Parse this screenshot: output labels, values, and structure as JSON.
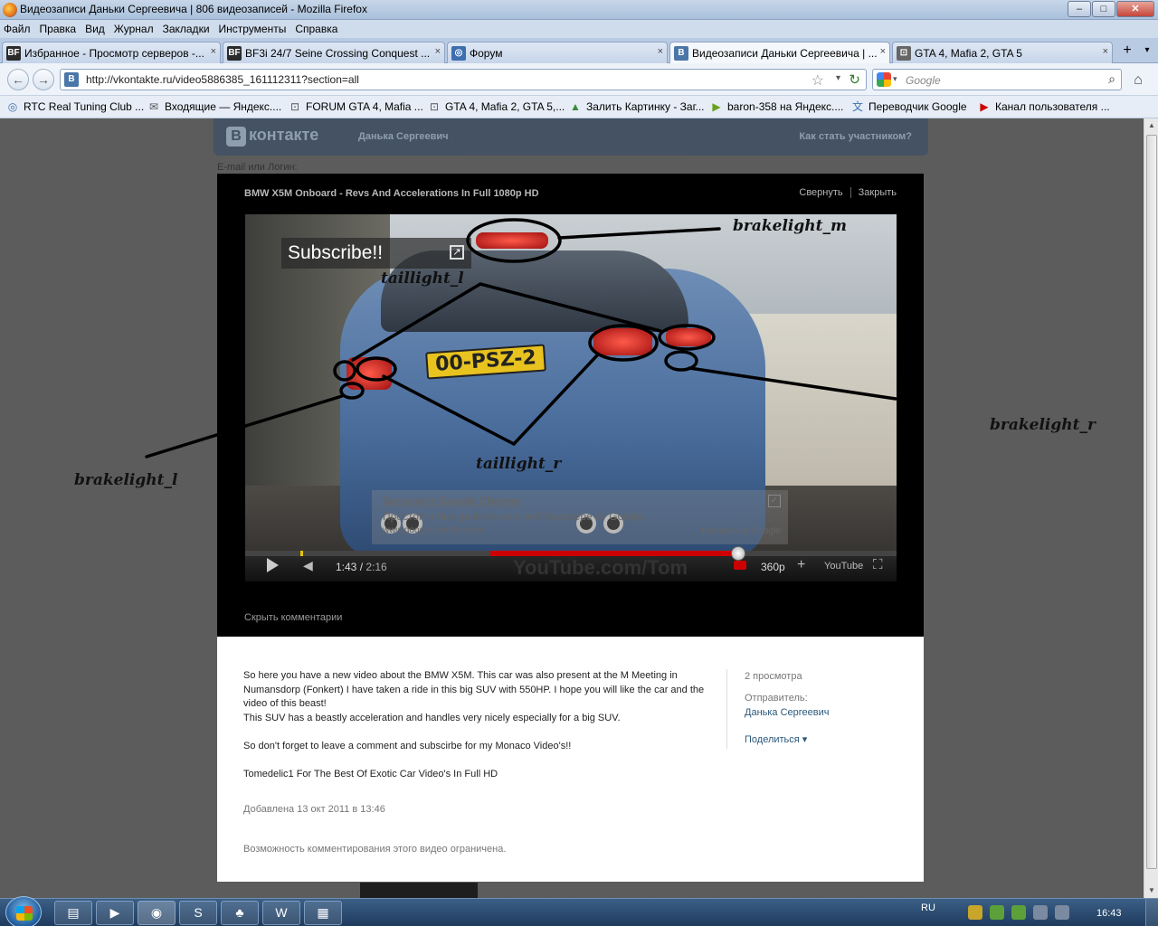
{
  "window": {
    "title": "Видеозаписи Даньки Сергеевича | 806 видеозаписей - Mozilla Firefox",
    "minimize": "–",
    "maximize": "□",
    "close": "✕"
  },
  "menu": [
    "Файл",
    "Правка",
    "Вид",
    "Журнал",
    "Закладки",
    "Инструменты",
    "Справка"
  ],
  "tabs": [
    {
      "label": "Избранное - Просмотр серверов -...",
      "icon_text": "BF",
      "icon_color": "#2a2a2a",
      "active": false
    },
    {
      "label": "BF3i 24/7 Seine Crossing Conquest ...",
      "icon_text": "BF",
      "icon_color": "#2a2a2a",
      "active": false
    },
    {
      "label": "Форум",
      "icon_text": "◎",
      "icon_color": "#3d6fb0",
      "active": false
    },
    {
      "label": "Видеозаписи Даньки Сергеевича | ...",
      "icon_text": "B",
      "icon_color": "#4a76a8",
      "active": true
    },
    {
      "label": "GTA 4, Mafia 2, GTA 5",
      "icon_text": "⊡",
      "icon_color": "#666",
      "active": false
    }
  ],
  "tab_close": "×",
  "nav": {
    "url": "http://vkontakte.ru/video5886385_161112311?section=all",
    "search_placeholder": "Google",
    "back": "←",
    "forward": "→",
    "star": "☆",
    "dropdown": "▾",
    "reload": "↻",
    "search_glyph": "⌕",
    "home": "⌂",
    "new_tab": "+",
    "tab_list": "▾",
    "site_icon": "B"
  },
  "bookmarks": [
    {
      "label": "RTC Real Tuning Club ...",
      "icon": "◎"
    },
    {
      "label": "Входящие — Яндекс....",
      "icon": "✉"
    },
    {
      "label": "FORUM GTA 4, Mafia ...",
      "icon": "⊡"
    },
    {
      "label": "GTA 4, Mafia 2, GTA 5,...",
      "icon": "⊡"
    },
    {
      "label": "Залить Картинку - Заг...",
      "icon": "▲"
    },
    {
      "label": "baron-358 на Яндекс....",
      "icon": "▶"
    },
    {
      "label": "Переводчик Google",
      "icon": "文"
    },
    {
      "label": "Канал пользователя ...",
      "icon": "▶"
    }
  ],
  "vk": {
    "logo": "контакте",
    "logo_b": "B",
    "crumb": "Данька Сергеевич",
    "join": "Как стать участником?",
    "login_label": "E-mail или Логин:"
  },
  "video": {
    "title": "BMW X5M Onboard - Revs And Accelerations In Full 1080p HD",
    "collapse": "Свернуть",
    "close": "Закрыть",
    "subscribe": "Subscribe!!",
    "ext_glyph": "↗",
    "plate": "00-PSZ-2",
    "ad_title": "Загрузите Google Chrome",
    "ad_text": "Простой и быстрый поиск в веб-браузере от Google",
    "ad_url": "www.google.com/chrome",
    "ad_label": "Реклама от Google",
    "ad_check": "✓",
    "time_current": "1:43",
    "time_duration": "2:16",
    "quality": "360p",
    "youtube": "YouTube",
    "watermark": "YouTube.com/Tom",
    "plus": "+",
    "fullscreen": "⛶",
    "volume_glyph": "◀",
    "progress": 0.757,
    "loaded_start": 0.376,
    "hide_comments": "Скрыть комментарии"
  },
  "annotations": {
    "brakelight_m": "brakelight_m",
    "taillight_l": "taillight_l",
    "taillight_r": "taillight_r",
    "brakelight_r": "brakelight_r",
    "brakelight_l": "brakelight_l"
  },
  "description": {
    "para1": "So here you have a new video about the BMW X5M. This car was also present at the M Meeting in Numansdorp (Fonkert) I have taken a ride in this big SUV with 550HP. I hope you will like the car and the video of this beast!",
    "para1b": "This SUV has a beastly acceleration and handles very nicely especially for a big SUV.",
    "para2": "So don't forget to leave a comment and subscirbe for my Monaco Video's!!",
    "para3": "Tomedelic1 For The Best Of Exotic Car Video's In Full HD",
    "added": "Добавлена 13 окт 2011 в 13:46",
    "restricted": "Возможность комментирования этого видео ограничена.",
    "views": "2 просмотра",
    "sender_label": "Отправитель:",
    "sender": "Данька Сергеевич",
    "share": "Поделиться ▾"
  },
  "taskbar": {
    "apps": [
      "▤",
      "▶",
      "◉",
      "S",
      "♣",
      "W",
      "▦"
    ],
    "lang": "RU",
    "clock": "16:43"
  }
}
